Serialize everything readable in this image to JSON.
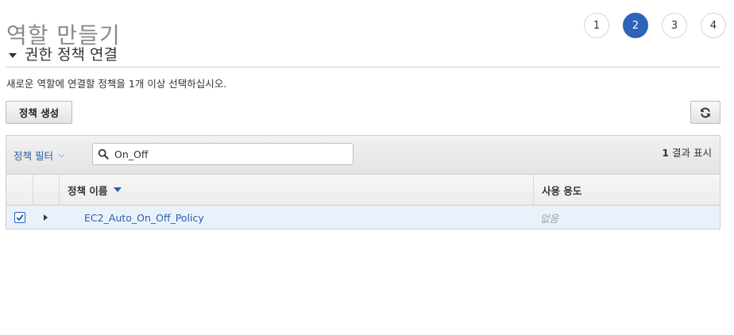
{
  "page": {
    "title": "역할 만들기"
  },
  "steps": [
    {
      "label": "1",
      "active": false
    },
    {
      "label": "2",
      "active": true
    },
    {
      "label": "3",
      "active": false
    },
    {
      "label": "4",
      "active": false
    }
  ],
  "section": {
    "title": "권한 정책 연결",
    "description": "새로운 역할에 연결할 정책을 1개 이상 선택하십시오."
  },
  "toolbar": {
    "create_policy_label": "정책 생성"
  },
  "filter": {
    "label": "정책 필터",
    "search_value": "On_Off",
    "results_count": "1",
    "results_suffix": " 결과 표시"
  },
  "table": {
    "columns": {
      "name": "정책 이름",
      "usage": "사용 용도"
    },
    "rows": [
      {
        "checked": true,
        "name": "EC2_Auto_On_Off_Policy",
        "usage": "없음"
      }
    ]
  },
  "colors": {
    "accent": "#2e63b8",
    "link": "#2b5ea7",
    "row_selected": "#e9f2fb"
  }
}
